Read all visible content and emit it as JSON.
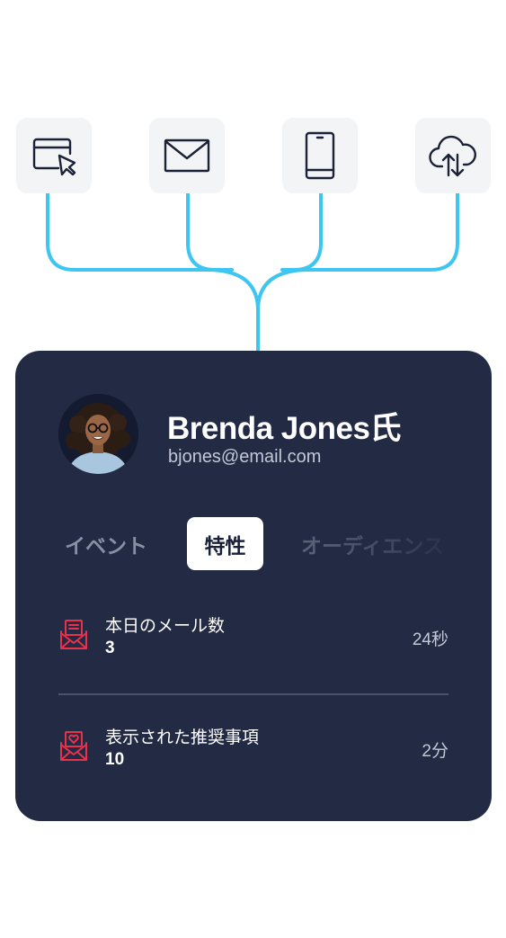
{
  "sources": [
    {
      "icon": "browser-cursor-icon"
    },
    {
      "icon": "envelope-icon"
    },
    {
      "icon": "smartphone-icon"
    },
    {
      "icon": "cloud-sync-icon"
    }
  ],
  "colors": {
    "connector": "#3ec6f0",
    "card_background": "#232a44",
    "tile_background": "#f3f4f6",
    "accent_red": "#e8324b",
    "icon_stroke": "#1b2238"
  },
  "profile": {
    "name": "Brenda Jones氏",
    "email": "bjones@email.com",
    "avatar": "avatar-photo"
  },
  "tabs": [
    {
      "label": "イベント",
      "active": false
    },
    {
      "label": "特性",
      "active": true
    },
    {
      "label": "オーディエンス",
      "active": false
    }
  ],
  "traits": [
    {
      "icon": "email-document-icon",
      "label": "本日のメール数",
      "value": "3",
      "time": "24秒"
    },
    {
      "icon": "email-heart-icon",
      "label": "表示された推奨事項",
      "value": "10",
      "time": "2分"
    }
  ]
}
